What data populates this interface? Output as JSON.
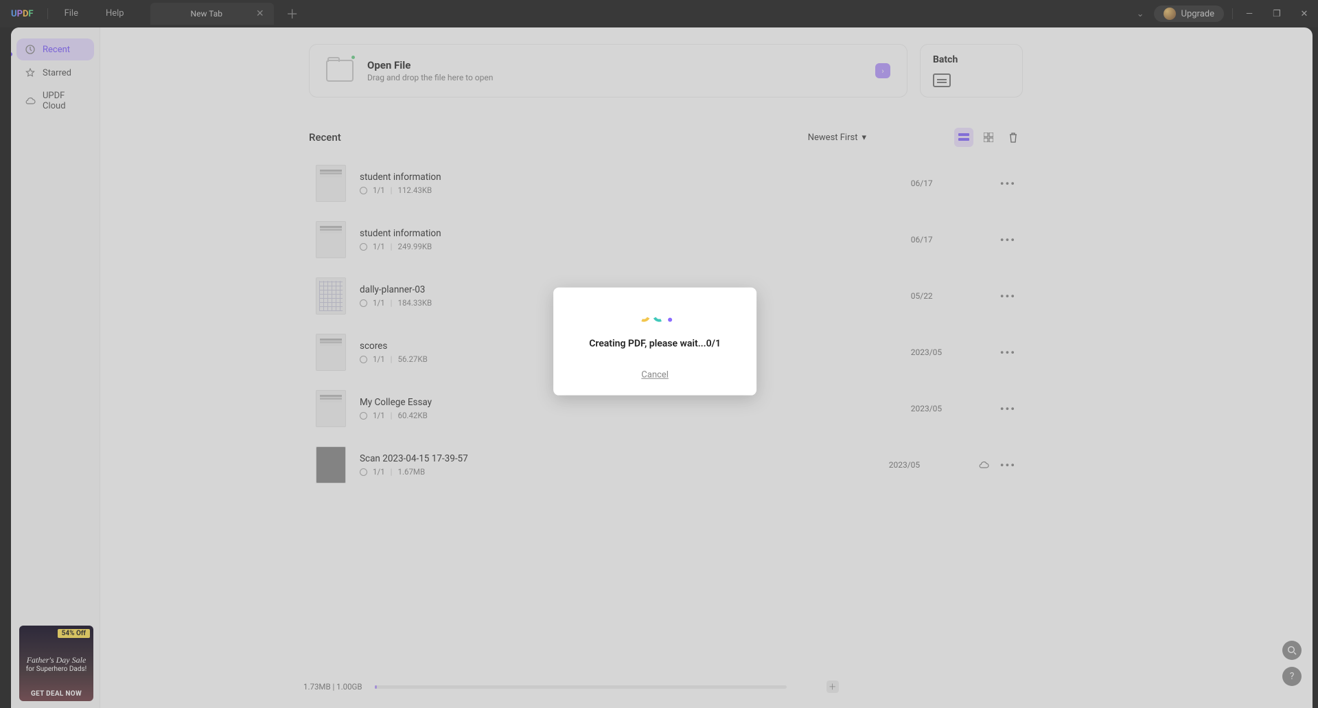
{
  "app": {
    "logo_letters": [
      "U",
      "P",
      "D",
      "F"
    ]
  },
  "menu": {
    "file": "File",
    "help": "Help"
  },
  "tab": {
    "title": "New Tab"
  },
  "upgrade_label": "Upgrade",
  "sidebar": {
    "items": [
      {
        "label": "Recent"
      },
      {
        "label": "Starred"
      },
      {
        "label": "UPDF Cloud"
      }
    ]
  },
  "open_card": {
    "title": "Open File",
    "subtitle": "Drag and drop the file here to open"
  },
  "batch_card": {
    "title": "Batch"
  },
  "recent": {
    "heading": "Recent",
    "sort_label": "Newest First",
    "items": [
      {
        "name": "student information",
        "pages": "1/1",
        "size": "112.43KB",
        "date": "06/17",
        "thumb": "lines"
      },
      {
        "name": "student information",
        "pages": "1/1",
        "size": "249.99KB",
        "date": "06/17",
        "thumb": "lines"
      },
      {
        "name": "dally-planner-03",
        "pages": "1/1",
        "size": "184.33KB",
        "date": "05/22",
        "thumb": "grid"
      },
      {
        "name": "scores",
        "pages": "1/1",
        "size": "56.27KB",
        "date": "2023/05",
        "thumb": "lines"
      },
      {
        "name": "My College Essay",
        "pages": "1/1",
        "size": "60.42KB",
        "date": "2023/05",
        "thumb": "lines"
      },
      {
        "name": "Scan 2023-04-15 17-39-57",
        "pages": "1/1",
        "size": "1.67MB",
        "date": "2023/05",
        "thumb": "scan",
        "cloud": true
      }
    ]
  },
  "storage_label": "1.73MB | 1.00GB",
  "modal": {
    "message": "Creating PDF, please wait...0/1",
    "cancel": "Cancel"
  },
  "promo": {
    "badge": "54% Off",
    "headline": "Father's Day Sale",
    "sub": "for Superhero Dads!",
    "cta": "GET DEAL NOW"
  }
}
